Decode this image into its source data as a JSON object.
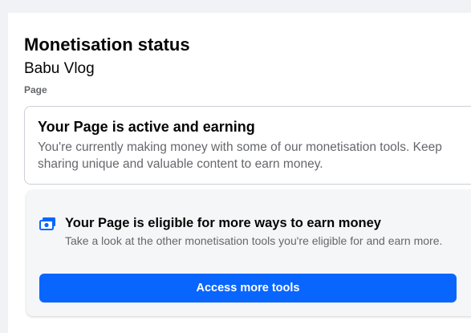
{
  "header": {
    "title": "Monetisation status",
    "page_name": "Babu Vlog",
    "page_type": "Page"
  },
  "status_card": {
    "title": "Your Page is active and earning",
    "description": "You're currently making money with some of our monetisation tools. Keep sharing unique and valuable content to earn money."
  },
  "eligible_card": {
    "icon": "money-icon",
    "title": "Your Page is eligible for more ways to earn money",
    "description": "Take a look at the other monetisation tools you're eligible for and earn more.",
    "button_label": "Access more tools"
  },
  "colors": {
    "accent": "#0866ff",
    "icon": "#0866ff",
    "background": "#f0f2f5"
  }
}
